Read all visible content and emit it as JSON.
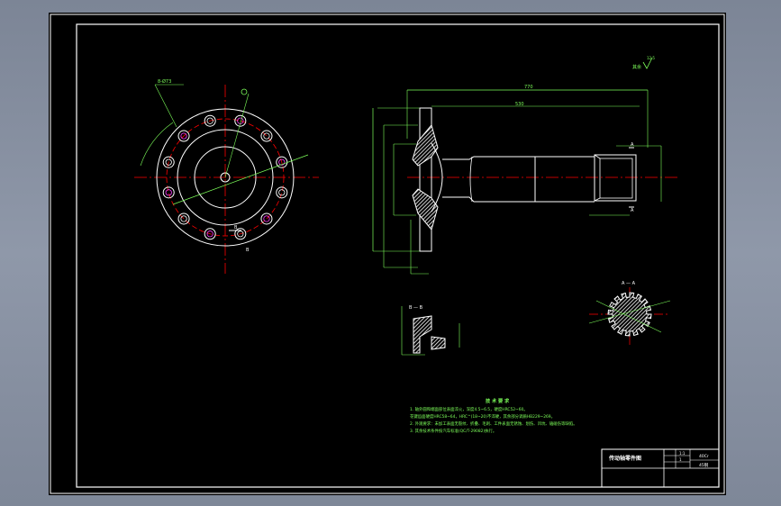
{
  "colors": {
    "background": "#000000",
    "outline": "#ffffff",
    "dimension": "#00ff00",
    "center": "#ff0000",
    "hatch": "#ffffff",
    "hole": "#ff00ff",
    "viewport": "#8b94a5"
  },
  "flange_view": {
    "dim_label_top": "8-Ø73",
    "section_mark_b": "B",
    "section_mark_b2": "B"
  },
  "main_view": {
    "overall_length": "770",
    "flange_to_spline": "530",
    "section_mark_a_top": "A",
    "section_mark_a_bottom": "A",
    "roughness_label": "其余",
    "roughness_value": "12.5"
  },
  "section_b": {
    "title": "B — B"
  },
  "section_a": {
    "title": "A — A"
  },
  "tech_notes": {
    "heading": "技 术 要 求",
    "lines": [
      "1. 轴外圆和端面部位表面淬火，深度4.5~6.5，硬度HRC52~60。",
      "   花键齿面硬度HRC58~64，HRC^(18~20)不淬硬，其余部分调质HB229~269。",
      "2. 外观要求：未加工表面无裂纹、折叠、毛刺、工件表面无锈蚀、划伤、凹坑、磕碰伤等缺陷。",
      "3. 其余技术条件按汽车标准(QC/T-29082)执行。"
    ]
  },
  "title_block": {
    "drawing_title": "传动轴零件图",
    "scale": "1:1",
    "sheet": "1",
    "material": "40Cr",
    "weight": "45钢"
  }
}
